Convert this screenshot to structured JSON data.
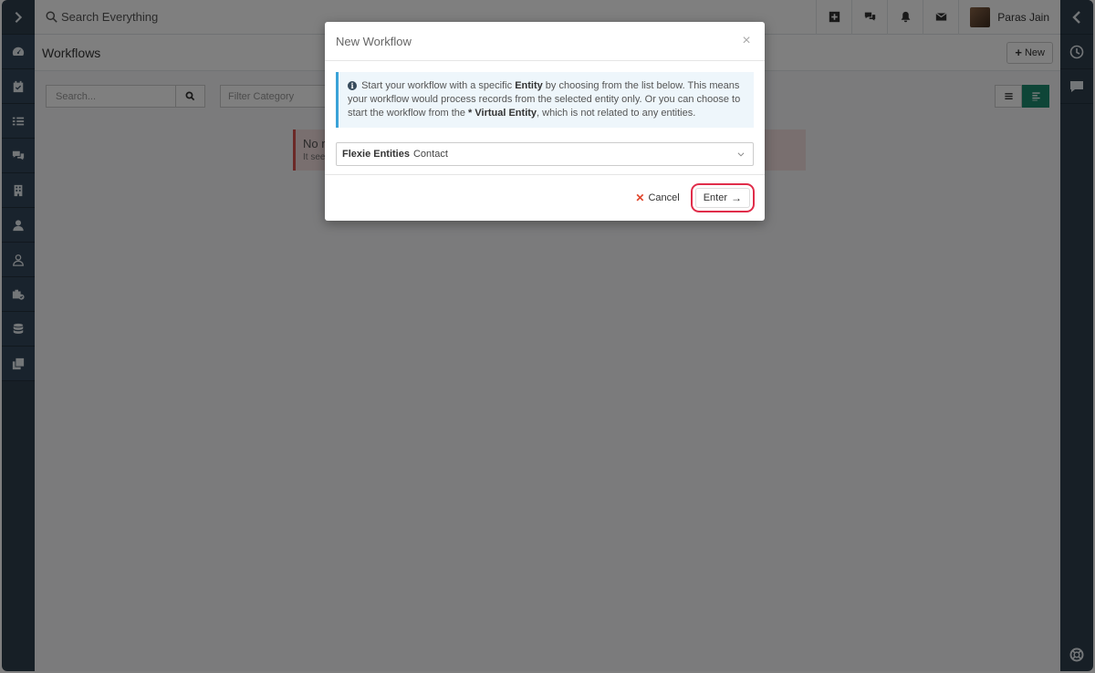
{
  "topbar": {
    "search_placeholder": "Search Everything",
    "user_name": "Paras Jain"
  },
  "page": {
    "title": "Workflows",
    "new_button": "New",
    "search_placeholder": "Search...",
    "filter_category": "Filter Category",
    "alert_title": "No r",
    "alert_sub": "It see"
  },
  "modal": {
    "title": "New Workflow",
    "info_part1": "Start your workflow with a specific ",
    "info_entity": "Entity",
    "info_part2": " by choosing from the list below. This means your workflow would process records from the selected entity only. Or you can choose to start the workflow from the ",
    "info_virtual": "* Virtual Entity",
    "info_part3": ", which is not related to any entities.",
    "select_group": "Flexie Entities",
    "select_value": "Contact",
    "cancel_label": "Cancel",
    "enter_label": "Enter"
  },
  "colors": {
    "sidebar": "#2f3e4c",
    "accent_green": "#1c8a6e",
    "highlight_red": "#e02d4a",
    "info_border": "#3ba3d8"
  }
}
